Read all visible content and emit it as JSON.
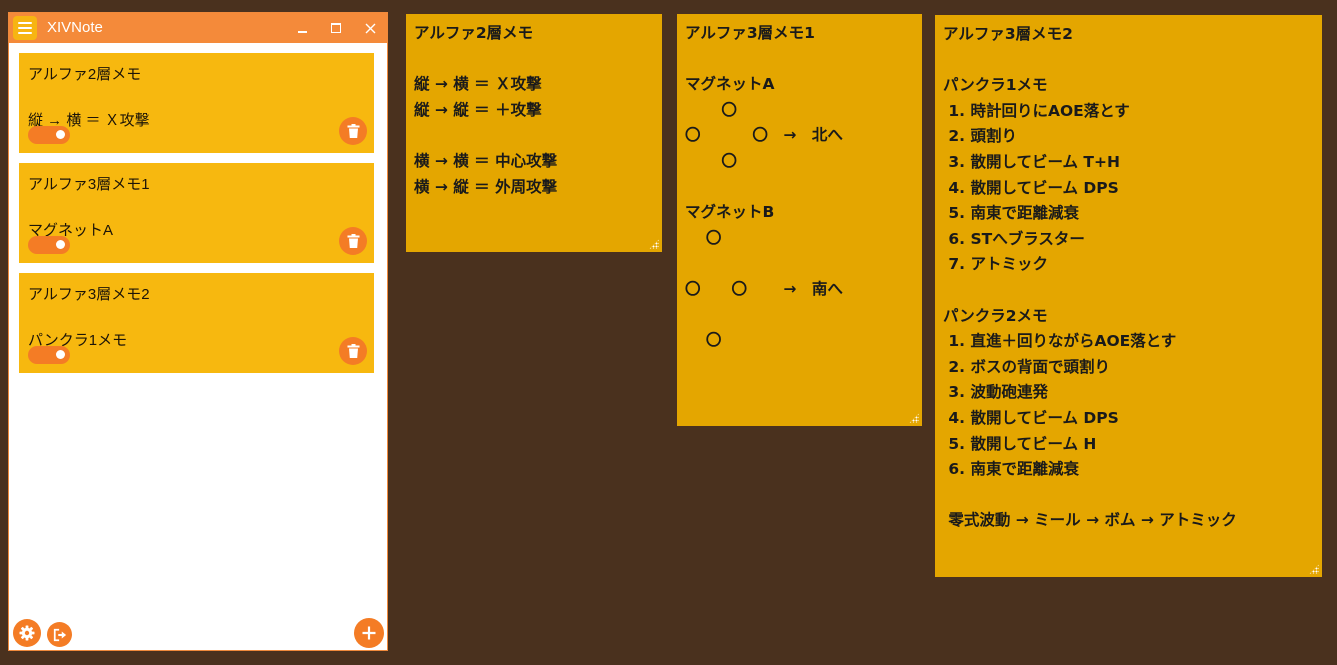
{
  "app": {
    "title": "XIVNote"
  },
  "notes": [
    {
      "title": "アルファ2層メモ",
      "preview": "縦 → 横 ＝ Ｘ攻撃",
      "enabled": true
    },
    {
      "title": "アルファ3層メモ1",
      "preview": "マグネットA",
      "enabled": true
    },
    {
      "title": "アルファ3層メモ2",
      "preview": "パンクラ1メモ",
      "enabled": true
    }
  ],
  "stickies": [
    {
      "title": "アルファ2層メモ",
      "lines": [
        "",
        "縦 → 横 ＝ Ｘ攻撃",
        "縦 → 縦 ＝ ＋攻撃",
        "",
        "横 → 横 ＝ 中心攻撃",
        "横 → 縦 ＝ 外周攻撃"
      ]
    },
    {
      "title": "アルファ3層メモ1",
      "lines": [
        "",
        "マグネットA",
        "　　 〇",
        "〇　　　 〇　→　北へ",
        "　　 〇",
        "",
        "マグネットB",
        "　 〇",
        "",
        "〇　　〇　　 →　南へ",
        "",
        "　 〇"
      ]
    },
    {
      "title": "アルファ3層メモ2",
      "lines": [
        "",
        "パンクラ1メモ",
        " 1. 時計回りにAOE落とす",
        " 2. 頭割り",
        " 3. 散開してビーム T+H",
        " 4. 散開してビーム DPS",
        " 5. 南東で距離減衰",
        " 6. STへブラスター",
        " 7. アトミック",
        "",
        "パンクラ2メモ",
        " 1. 直進＋回りながらAOE落とす",
        " 2. ボスの背面で頭割り",
        " 3. 波動砲連発",
        " 4. 散開してビーム DPS",
        " 5. 散開してビーム H",
        " 6. 南東で距離減衰",
        "",
        " 零式波動 → ミール → ボム → アトミック"
      ]
    }
  ],
  "icons": {
    "menu": "hamburger-icon",
    "minimize": "minimize-icon",
    "maximize": "maximize-icon",
    "close": "close-icon",
    "delete": "trash-icon",
    "settings": "gear-icon",
    "exit": "exit-icon",
    "add": "plus-icon"
  },
  "colors": {
    "accent": "#f48a3a",
    "card": "#f7b80f",
    "sticky": "#e4a600",
    "desktop": "#4a311e"
  }
}
